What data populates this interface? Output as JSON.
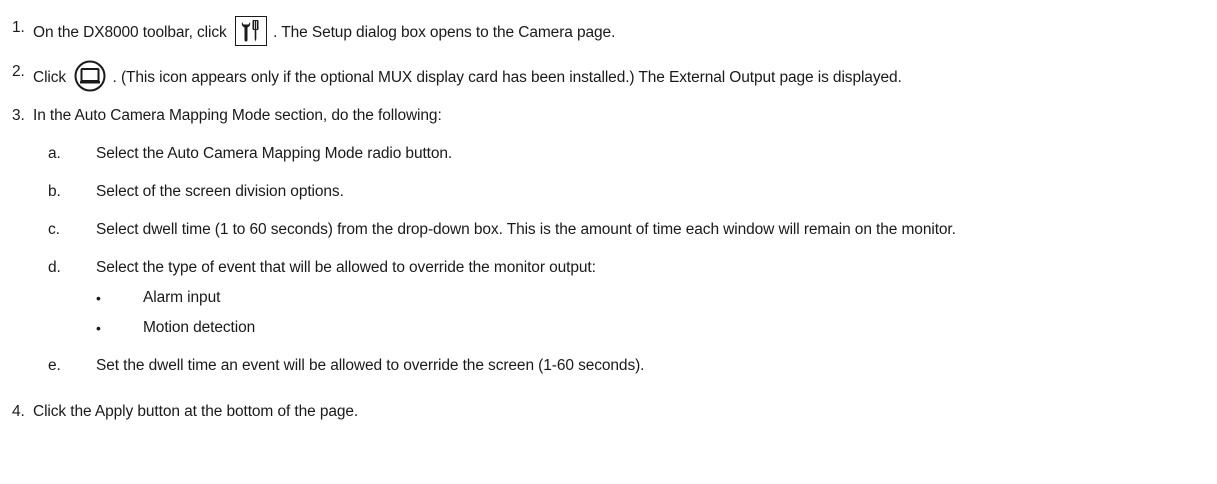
{
  "steps": [
    {
      "num": "1.",
      "text_before": "On the DX8000 toolbar, click",
      "icon": "wrench-screwdriver-icon",
      "text_after": ". The Setup dialog box opens to the Camera page."
    },
    {
      "num": "2.",
      "text_before": "Click",
      "icon": "monitor-icon",
      "text_after": ". (This icon appears only if the optional MUX display card has been installed.) The External Output page is displayed."
    },
    {
      "num": "3.",
      "text": "In the Auto Camera Mapping Mode section, do the following:",
      "substeps": [
        {
          "letter": "a.",
          "text": "Select the Auto Camera Mapping Mode radio button."
        },
        {
          "letter": "b.",
          "text": "Select of the screen division options."
        },
        {
          "letter": "c.",
          "text": "Select dwell time (1 to 60 seconds) from the drop-down box. This is the amount of time each window will remain on the monitor."
        },
        {
          "letter": "d.",
          "text": "Select the type of event that will be allowed to override the monitor output:",
          "bullets": [
            "Alarm input",
            "Motion detection"
          ]
        },
        {
          "letter": "e.",
          "text": "Set the dwell time an event will be allowed to override the screen (1-60 seconds)."
        }
      ]
    },
    {
      "num": "4.",
      "text": "Click the Apply button at the bottom of the page."
    }
  ],
  "bullet_glyph": "•"
}
